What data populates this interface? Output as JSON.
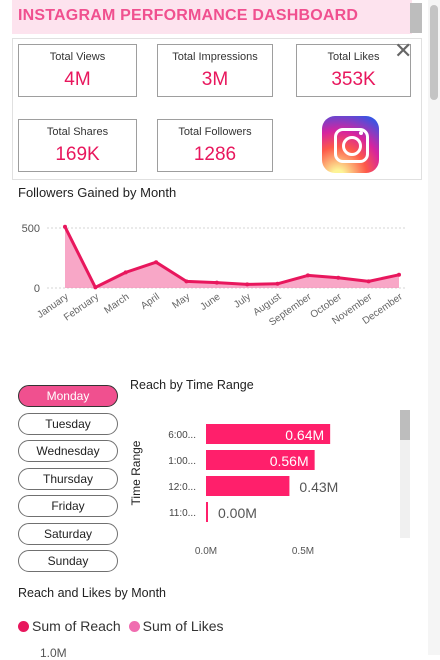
{
  "dashboard": {
    "title": "INSTAGRAM PERFORMANCE DASHBOARD",
    "brand_color": "#e8175d",
    "accent_color": "#f0508f"
  },
  "kpis": [
    {
      "label": "Total Views",
      "value": "4M"
    },
    {
      "label": "Total Impressions",
      "value": "3M"
    },
    {
      "label": "Total Likes",
      "value": "353K"
    },
    {
      "label": "Total Shares",
      "value": "169K"
    },
    {
      "label": "Total Followers",
      "value": "1286"
    }
  ],
  "icons": {
    "close": "close-icon",
    "logo": "instagram-logo-icon"
  },
  "followers_chart": {
    "title": "Followers Gained by Month"
  },
  "reach_chart": {
    "title": "Reach by Time Range"
  },
  "day_slicer": {
    "items": [
      "Monday",
      "Tuesday",
      "Wednesday",
      "Thursday",
      "Friday",
      "Saturday",
      "Sunday"
    ],
    "selected": "Monday"
  },
  "reach_likes": {
    "title": "Reach and Likes by Month",
    "legend": [
      {
        "label": "Sum of Reach",
        "color": "#e8175d"
      },
      {
        "label": "Sum of Likes",
        "color": "#f06db0"
      }
    ],
    "axis_top": "1.0M"
  },
  "chart_data": [
    {
      "type": "area",
      "title": "Followers Gained by Month",
      "categories": [
        "January",
        "February",
        "March",
        "April",
        "May",
        "June",
        "July",
        "August",
        "September",
        "October",
        "November",
        "December"
      ],
      "values": [
        510,
        5,
        130,
        215,
        55,
        45,
        30,
        35,
        105,
        85,
        55,
        110
      ],
      "yticks": [
        "0",
        "500"
      ],
      "ylim": [
        0,
        550
      ],
      "grid": true,
      "line_color": "#e8175d",
      "fill_color": "#f58ab4"
    },
    {
      "type": "bar",
      "orientation": "horizontal",
      "title": "Reach by Time Range",
      "ylabel": "Time Range",
      "categories": [
        "6:00...",
        "1:00...",
        "12:0...",
        "11:0..."
      ],
      "values": [
        0.64,
        0.56,
        0.43,
        0.0
      ],
      "data_labels": [
        "0.64M",
        "0.56M",
        "0.43M",
        "0.00M"
      ],
      "xticks": [
        "0.0M",
        "0.5M"
      ],
      "xlim": [
        0,
        0.7
      ],
      "bar_color": "#ff1f6b"
    }
  ]
}
